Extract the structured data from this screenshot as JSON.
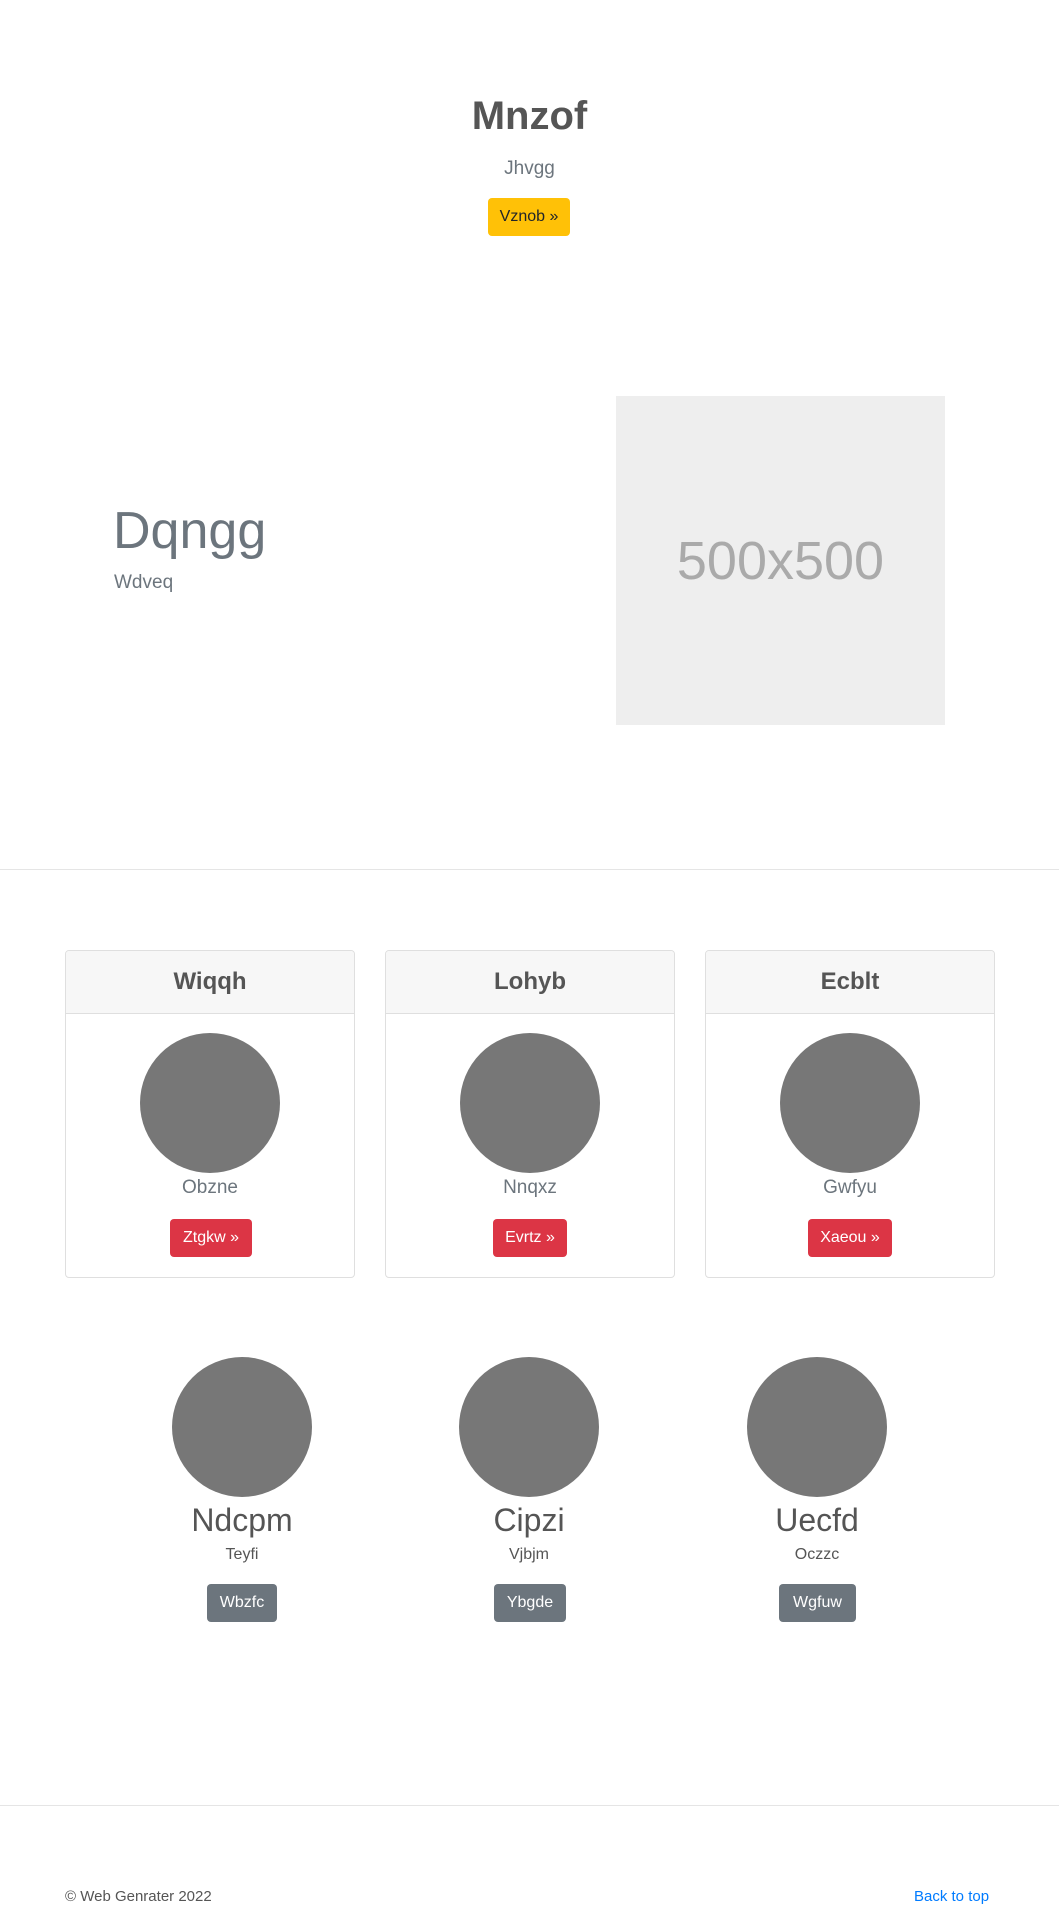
{
  "hero": {
    "title": "Mnzof",
    "subtitle": "Jhvgg",
    "button_label": "Vznob »"
  },
  "feature": {
    "heading": "Dqngg",
    "subheading": "Wdveq",
    "image_label": "500x500"
  },
  "cards": [
    {
      "title": "Wiqqh",
      "text": "Obzne",
      "button_label": "Ztgkw »"
    },
    {
      "title": "Lohyb",
      "text": "Nnqxz",
      "button_label": "Evrtz »"
    },
    {
      "title": "Ecblt",
      "text": "Gwfyu",
      "button_label": "Xaeou »"
    }
  ],
  "team": [
    {
      "name": "Ndcpm",
      "role": "Teyfi",
      "button_label": "Wbzfc"
    },
    {
      "name": "Cipzi",
      "role": "Vjbjm",
      "button_label": "Ybgde"
    },
    {
      "name": "Uecfd",
      "role": "Oczzc",
      "button_label": "Wgfuw"
    }
  ],
  "footer": {
    "copyright": "© Web Genrater 2022",
    "back_to_top": "Back to top"
  },
  "colors": {
    "warning": "#ffc107",
    "danger": "#dc3545",
    "secondary": "#6c757d",
    "link": "#007bff",
    "avatar": "#777777",
    "placeholder_bg": "#eeeeee"
  }
}
